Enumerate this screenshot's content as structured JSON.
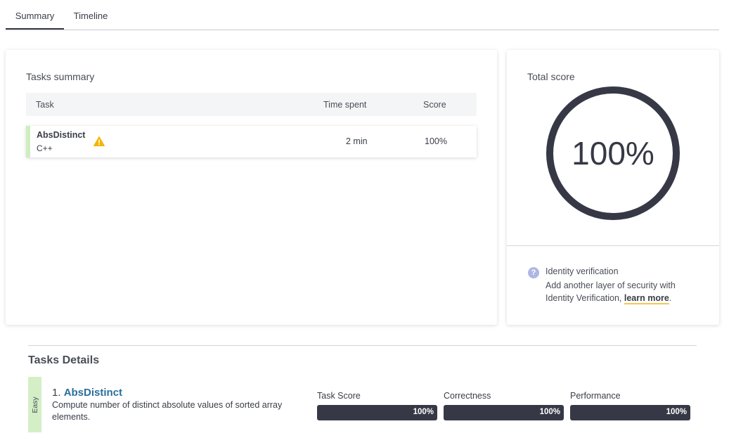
{
  "tabs": [
    {
      "label": "Summary",
      "active": true
    },
    {
      "label": "Timeline",
      "active": false
    }
  ],
  "tasks_summary": {
    "title": "Tasks summary",
    "columns": {
      "task": "Task",
      "time_spent": "Time spent",
      "score": "Score"
    },
    "rows": [
      {
        "name": "AbsDistinct",
        "language": "C++",
        "time_spent": "2 min",
        "score": "100%",
        "warning_icon": "warning-triangle-icon"
      }
    ]
  },
  "total_score": {
    "title": "Total score",
    "value": "100%",
    "percent": 100
  },
  "identity_verification": {
    "title": "Identity verification",
    "text_prefix": "Add another layer of security with Identity Verification, ",
    "link": "learn more",
    "text_suffix": "."
  },
  "tasks_details": {
    "title": "Tasks Details",
    "items": [
      {
        "difficulty": "Easy",
        "number": "1.",
        "name": "AbsDistinct",
        "description": "Compute number of distinct absolute values of sorted array elements.",
        "metrics": [
          {
            "label": "Task Score",
            "value": "100%",
            "percent": 100
          },
          {
            "label": "Correctness",
            "value": "100%",
            "percent": 100
          },
          {
            "label": "Performance",
            "value": "100%",
            "percent": 100
          }
        ]
      }
    ]
  },
  "colors": {
    "accent_dark": "#363945",
    "easy_green": "#d4efc6",
    "row_accent": "#cfeec0",
    "warning": "#f4b400",
    "link_underline": "#f2c94c",
    "help_icon": "#aeb7e4",
    "task_link": "#2a6f9b"
  }
}
